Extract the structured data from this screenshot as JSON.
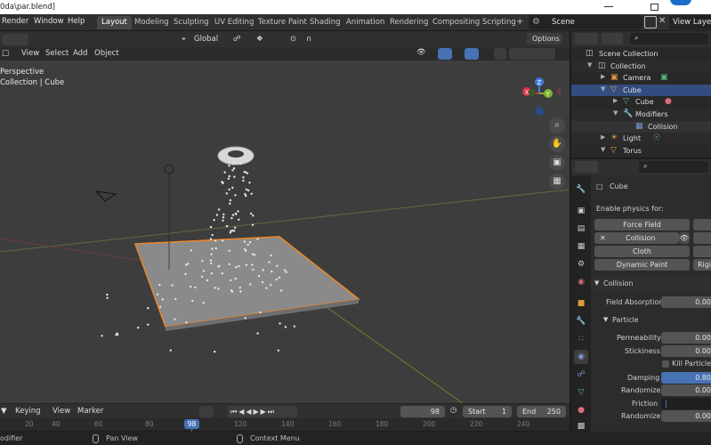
{
  "window": {
    "title": "0da\\par.blend]"
  },
  "menu": {
    "items": [
      "Render",
      "Window",
      "Help"
    ]
  },
  "workspaces": [
    "Layout",
    "Modeling",
    "Sculpting",
    "UV Editing",
    "Texture Paint",
    "Shading",
    "Animation",
    "Rendering",
    "Compositing",
    "Scripting"
  ],
  "active_workspace": "Layout",
  "scene": {
    "name": "Scene",
    "view_layer": "View Layer"
  },
  "viewport": {
    "header_menu": [
      "View",
      "Select",
      "Add",
      "Object"
    ],
    "transform_orientation": "Global",
    "options_label": "Options",
    "overlay_text_1": "Perspective",
    "overlay_text_2": "Collection | Cube",
    "gizmo_axes": {
      "z": "Z",
      "y": "Y",
      "x": "X"
    }
  },
  "timeline": {
    "menu": [
      "Keying",
      "View",
      "Marker"
    ],
    "current_frame": "98",
    "start_label": "Start",
    "start": "1",
    "end_label": "End",
    "end": "250",
    "ticks": [
      "20",
      "40",
      "60",
      "80",
      "120",
      "140",
      "160",
      "180",
      "200",
      "220",
      "240"
    ],
    "cursor_label": "98"
  },
  "statusbar": {
    "left": "odifier",
    "middle": "Pan View",
    "right": "Context Menu"
  },
  "outliner": {
    "rows": [
      {
        "label": "Scene Collection"
      },
      {
        "label": "Collection"
      },
      {
        "label": "Camera"
      },
      {
        "label": "Cube"
      },
      {
        "label": "Cube"
      },
      {
        "label": "Modifiers"
      },
      {
        "label": "Collision"
      },
      {
        "label": "Light"
      },
      {
        "label": "Torus"
      }
    ]
  },
  "properties": {
    "object_name": "Cube",
    "enable_physics_label": "Enable physics for:",
    "buttons": {
      "force_field": "Force Field",
      "collision": "Collision",
      "cloth": "Cloth",
      "dynamic_paint": "Dynamic Paint",
      "rigid": "Rigi"
    },
    "collision_panel": "Collision",
    "field_absorption_label": "Field Absorption",
    "field_absorption": "0.00",
    "particle_panel": "Particle",
    "permeability_label": "Permeability",
    "permeability": "0.00",
    "stickiness_label": "Stickiness",
    "stickiness": "0.00",
    "kill_particles_label": "Kill Particles",
    "damping_label": "Damping",
    "damping": "0.80",
    "randomize_label_1": "Randomize",
    "randomize_1": "0.00",
    "friction_label": "Friction",
    "randomize_label_2": "Randomize",
    "randomize_2": "0.00"
  },
  "colors": {
    "accent": "#4772b3",
    "selection_outline": "#e8872d",
    "axis_x": "#d8324a",
    "axis_y": "#7cb32f",
    "axis_z": "#3d7ddb"
  }
}
